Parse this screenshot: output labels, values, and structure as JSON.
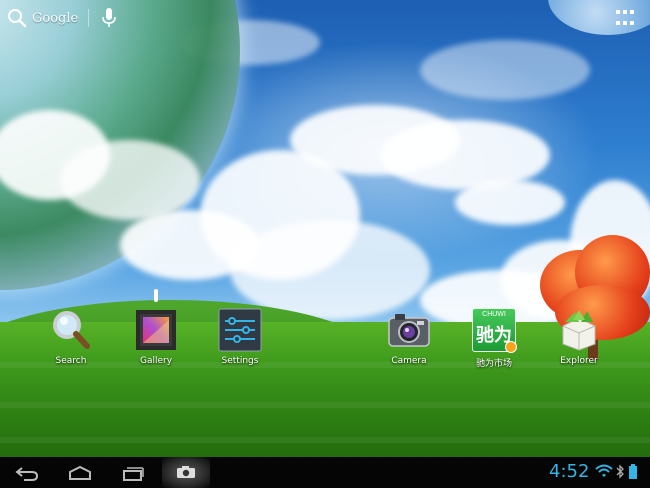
{
  "search_bar": {
    "label": "Google",
    "icon": "search-icon"
  },
  "top_right": {
    "icon": "apps-grid-icon"
  },
  "shortcuts": [
    {
      "label": "Search",
      "icon": "magnifier-icon"
    },
    {
      "label": "Gallery",
      "icon": "gallery-icon"
    },
    {
      "label": "Settings",
      "icon": "settings-sliders-icon"
    },
    {
      "label": "Camera",
      "icon": "camera-icon"
    },
    {
      "label": "驰为市场",
      "icon": "chuwi-market-icon",
      "icon_text": "CHUWI",
      "icon_cn": "驰为"
    },
    {
      "label": "Explorer",
      "icon": "explorer-box-icon"
    }
  ],
  "navbar": {
    "buttons": [
      "back-icon",
      "home-icon",
      "recent-apps-icon",
      "screenshot-camera-icon"
    ],
    "clock": "4:52",
    "status_icons": [
      "wifi-icon",
      "bluetooth-icon",
      "battery-icon"
    ]
  },
  "colors": {
    "clock": "#35b5e5",
    "navbar": "#050505"
  }
}
